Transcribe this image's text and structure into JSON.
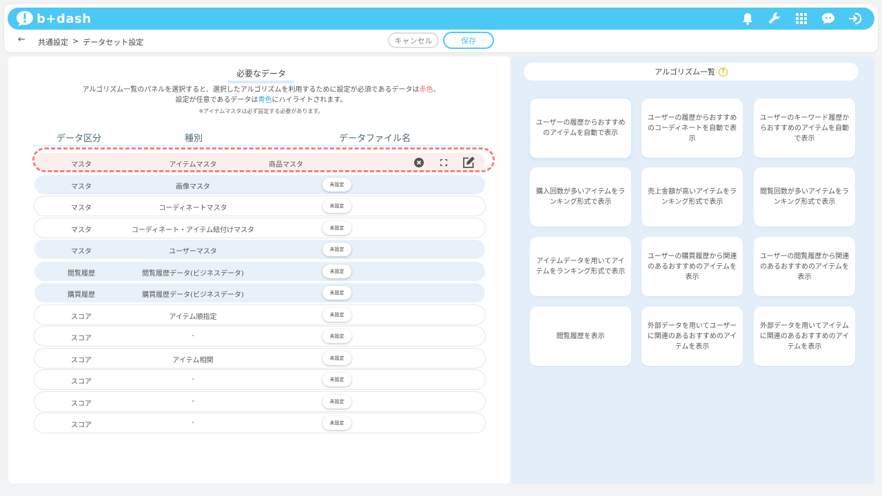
{
  "app": {
    "logo_text": "b+dash",
    "brand_color": "#4cc8f4"
  },
  "header": {
    "icons": [
      "bell-icon",
      "wrench-icon",
      "grid-icon",
      "chat-bot-icon",
      "logout-icon"
    ]
  },
  "subbar": {
    "breadcrumb": [
      "共通設定",
      ">",
      "データセット設定"
    ],
    "cancel_label": "キャンセル",
    "save_label": "保存"
  },
  "left": {
    "title": "必要なデータ",
    "desc_line1_a": "アルゴリズム一覧のパネルを選択すると、選択したアルゴリズムを利用するために設定が必須であるデータは",
    "desc_red": "赤色",
    "desc_line1_b": "、",
    "desc_line2_a": "設定が任意であるデータは",
    "desc_blue": "青色",
    "desc_line2_b": "にハイライトされます。",
    "note": "※アイテムマスタは必ず設定する必要があります。",
    "columns": [
      "データ区分",
      "種別",
      "データファイル名"
    ],
    "rows": [
      {
        "category": "マスタ",
        "type": "アイテムマスタ",
        "file": "商品マスタ",
        "status": "",
        "style": "selected"
      },
      {
        "category": "マスタ",
        "type": "画像マスタ",
        "file": "",
        "status": "未設定",
        "style": "blue"
      },
      {
        "category": "マスタ",
        "type": "コーディネートマスタ",
        "file": "",
        "status": "未設定",
        "style": "white"
      },
      {
        "category": "マスタ",
        "type": "コーディネート・アイテム紐付けマスタ",
        "file": "",
        "status": "未設定",
        "style": "white"
      },
      {
        "category": "マスタ",
        "type": "ユーザーマスタ",
        "file": "",
        "status": "未設定",
        "style": "blue"
      },
      {
        "category": "閲覧履歴",
        "type": "閲覧履歴データ(ビジネスデータ)",
        "file": "",
        "status": "未設定",
        "style": "blue"
      },
      {
        "category": "購買履歴",
        "type": "購買履歴データ(ビジネスデータ)",
        "file": "",
        "status": "未設定",
        "style": "blue"
      },
      {
        "category": "スコア",
        "type": "アイテム順指定",
        "file": "",
        "status": "未設定",
        "style": "white"
      },
      {
        "category": "スコア",
        "type": "-",
        "file": "",
        "status": "未設定",
        "style": "white"
      },
      {
        "category": "スコア",
        "type": "アイテム相関",
        "file": "",
        "status": "未設定",
        "style": "white"
      },
      {
        "category": "スコア",
        "type": "-",
        "file": "",
        "status": "未設定",
        "style": "white"
      },
      {
        "category": "スコア",
        "type": "-",
        "file": "",
        "status": "未設定",
        "style": "white"
      },
      {
        "category": "スコア",
        "type": "-",
        "file": "",
        "status": "未設定",
        "style": "white"
      }
    ],
    "selected_row_icons": [
      "clear-icon",
      "expand-icon",
      "edit-icon"
    ]
  },
  "right": {
    "title": "アルゴリズム一覧",
    "help": "?",
    "cards": [
      "ユーザーの履歴からおすすめのアイテムを自動で表示",
      "ユーザーの履歴からおすすめのコーディネートを自動で表示",
      "ユーザーのキーワード履歴からおすすめのアイテムを自動で表示",
      "購入回数が多いアイテムをランキング形式で表示",
      "売上金額が高いアイテムをランキング形式で表示",
      "閲覧回数が多いアイテムをランキング形式で表示",
      "アイテムデータを用いてアイテムをランキング形式で表示",
      "ユーザーの購買履歴から関連のあるおすすめのアイテムを表示",
      "ユーザーの閲覧履歴から関連のあるおすすめのアイテムを表示",
      "閲覧履歴を表示",
      "外部データを用いてユーザーに関連のあるおすすめのアイテムを表示",
      "外部データを用いてアイテムに関連のあるおすすめのアイテムを表示"
    ]
  }
}
